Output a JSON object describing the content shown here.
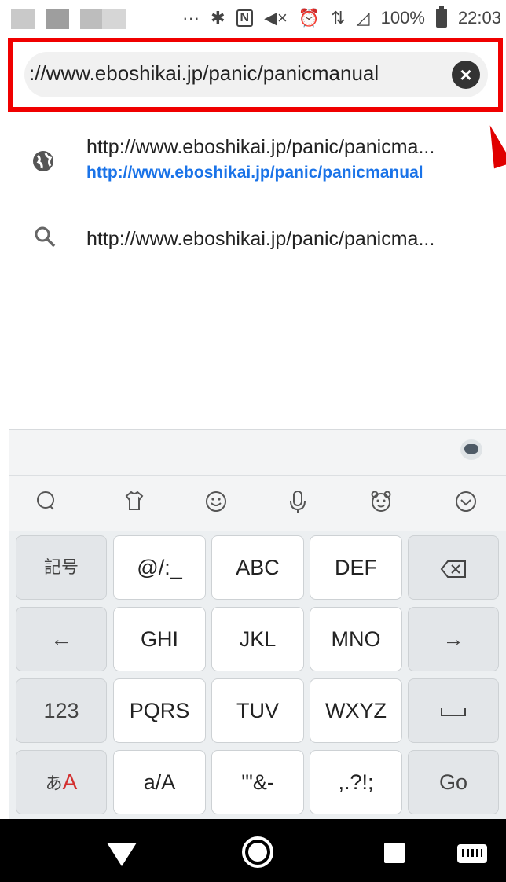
{
  "status_bar": {
    "dots": "···",
    "battery_percent": "100%",
    "time": "22:03",
    "icons": [
      "bluetooth-icon",
      "nfc-icon",
      "mute-icon",
      "alarm-icon",
      "data-arrows-icon",
      "wifi-icon",
      "signal-icon",
      "battery-charging-icon"
    ]
  },
  "url_bar": {
    "value": "://www.eboshikai.jp/panic/panicmanual",
    "clear_icon": "clear-icon"
  },
  "suggestions": [
    {
      "icon": "globe-icon",
      "title": "http://www.eboshikai.jp/panic/panicma...",
      "subtitle": "http://www.eboshikai.jp/panic/panicmanual"
    },
    {
      "icon": "search-icon",
      "title": "http://www.eboshikai.jp/panic/panicma..."
    }
  ],
  "keyboard": {
    "toolbar_icons": [
      "chat-icon",
      "shirt-icon",
      "smiley-icon",
      "mic-icon",
      "bear-icon",
      "collapse-icon"
    ],
    "rows": [
      [
        "記号",
        "@/:_",
        "ABC",
        "DEF",
        "⌫"
      ],
      [
        "←",
        "GHI",
        "JKL",
        "MNO",
        "→"
      ],
      [
        "123",
        "PQRS",
        "TUV",
        "WXYZ",
        "␣"
      ],
      [
        "あA",
        "a/A",
        "'\"&-",
        ",.?!;",
        "Go"
      ]
    ]
  },
  "nav_bar": {
    "icons": [
      "back-icon",
      "home-icon",
      "recents-icon",
      "keyboard-icon"
    ]
  }
}
